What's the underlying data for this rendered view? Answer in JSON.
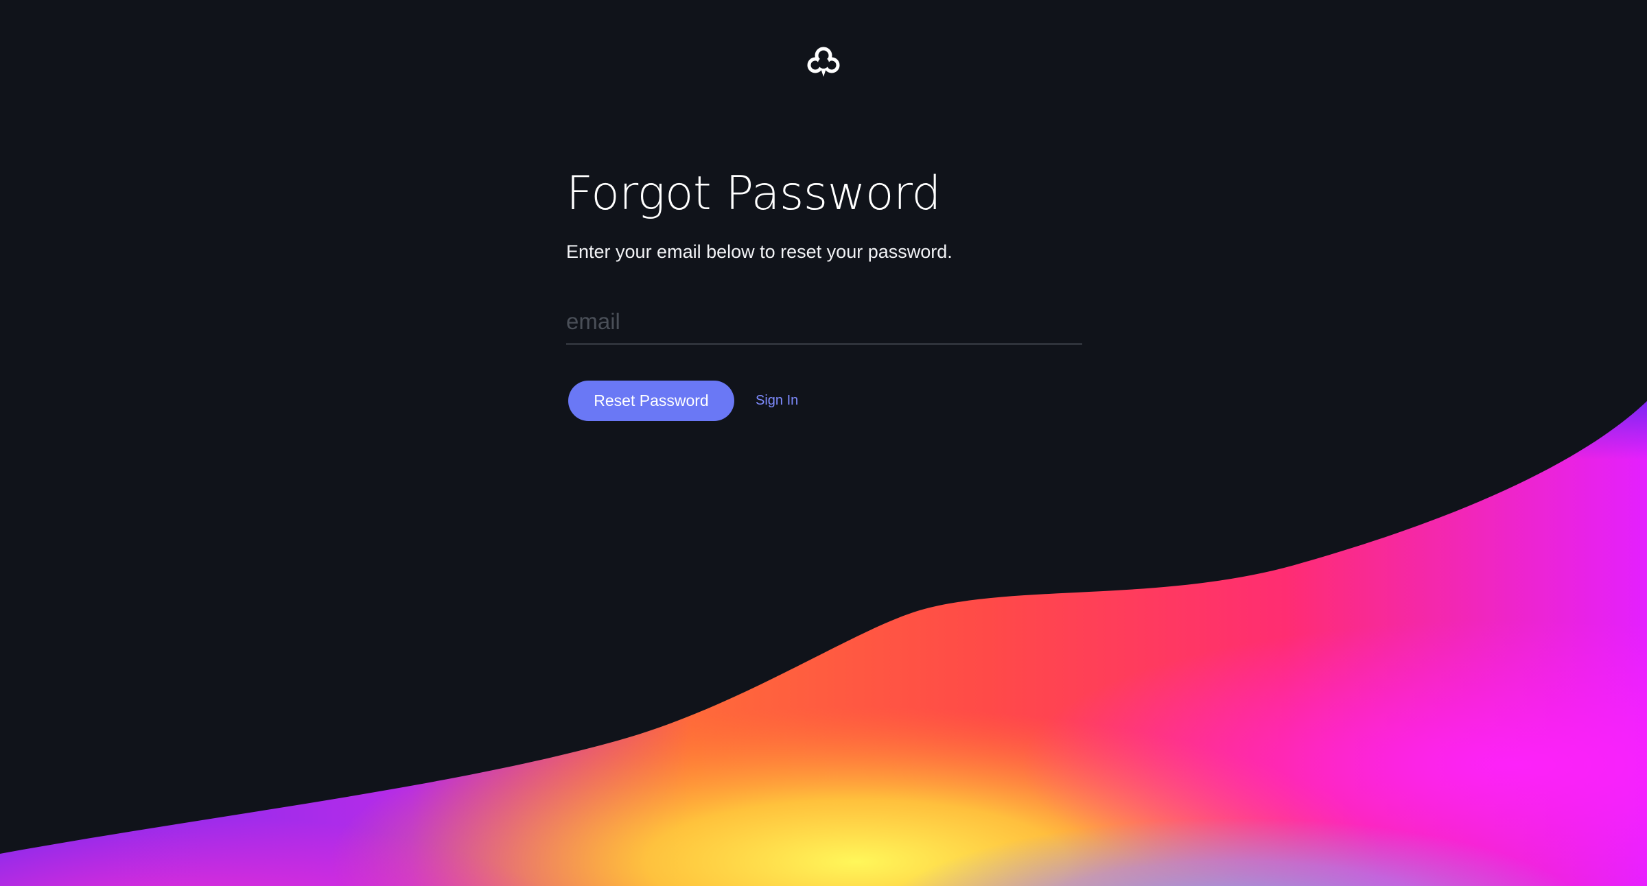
{
  "logo": {
    "icon": "cloud-logo-icon",
    "color": "#ffffff"
  },
  "form": {
    "title": "Forgot Password",
    "subtitle": "Enter your email below to reset your password.",
    "email_placeholder": "email",
    "email_value": "",
    "reset_button_label": "Reset Password",
    "sign_in_label": "Sign In"
  },
  "colors": {
    "background": "#10131a",
    "accent": "#6a78f5",
    "link": "#7f8cff",
    "input_border": "#2f333b"
  }
}
